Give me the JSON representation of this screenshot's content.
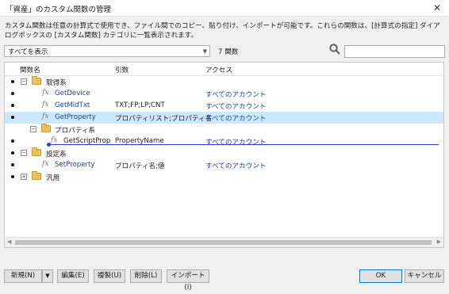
{
  "window": {
    "title": "「資産」のカスタム関数の管理",
    "close_glyph": "✕"
  },
  "description": "カスタム関数は任意の計算式で使用でき、ファイル間でのコピー、貼り付け、インポートが可能です。これらの関数は、[計算式の指定] ダイアログボックスの [カスタム関数] カテゴリに一覧表示されます。",
  "filter": {
    "selected": "すべてを表示",
    "count_label": "7 関数"
  },
  "search": {
    "placeholder": "",
    "value": ""
  },
  "columns": {
    "name": "関数名",
    "params": "引数",
    "access": "アクセス"
  },
  "rows": [
    {
      "type": "folder",
      "expanded": true,
      "name": "取得系"
    },
    {
      "type": "function",
      "name": "GetDevice",
      "params": "",
      "access": "すべてのアカウント"
    },
    {
      "type": "function",
      "name": "GetMidTxt",
      "params": "TXT;FP;LP;CNT",
      "access": "すべてのアカウント"
    },
    {
      "type": "function",
      "name": "GetProperty",
      "params": "プロパティリスト;プロパティ名",
      "access": "すべてのアカウント",
      "selected": true
    },
    {
      "type": "folder",
      "expanded": true,
      "name": "プロパティ系"
    },
    {
      "type": "function",
      "name": "GetScriptProperty",
      "params": "PropertyName",
      "access": "すべてのアカウント"
    },
    {
      "type": "folder",
      "expanded": true,
      "name": "設定系"
    },
    {
      "type": "function",
      "name": "SetProperty",
      "params": "プロパティ名;値",
      "access": "すべてのアカウント"
    },
    {
      "type": "folder",
      "expanded": false,
      "name": "汎用"
    }
  ],
  "icons": {
    "folder": "folder-icon",
    "function": "fx-icon",
    "search": "search-icon",
    "fx_glyph": "fx"
  },
  "buttons": {
    "new": "新規(N)",
    "edit": "編集(E)",
    "duplicate": "複製(U)",
    "delete": "削除(L)",
    "import": "インポート(I)",
    "ok": "OK",
    "cancel": "キャンセル",
    "dropdown_glyph": "▼"
  },
  "colors": {
    "selection": "#cce8ff",
    "link": "#1f3fa6",
    "drop_indicator": "#2b3bd4"
  }
}
